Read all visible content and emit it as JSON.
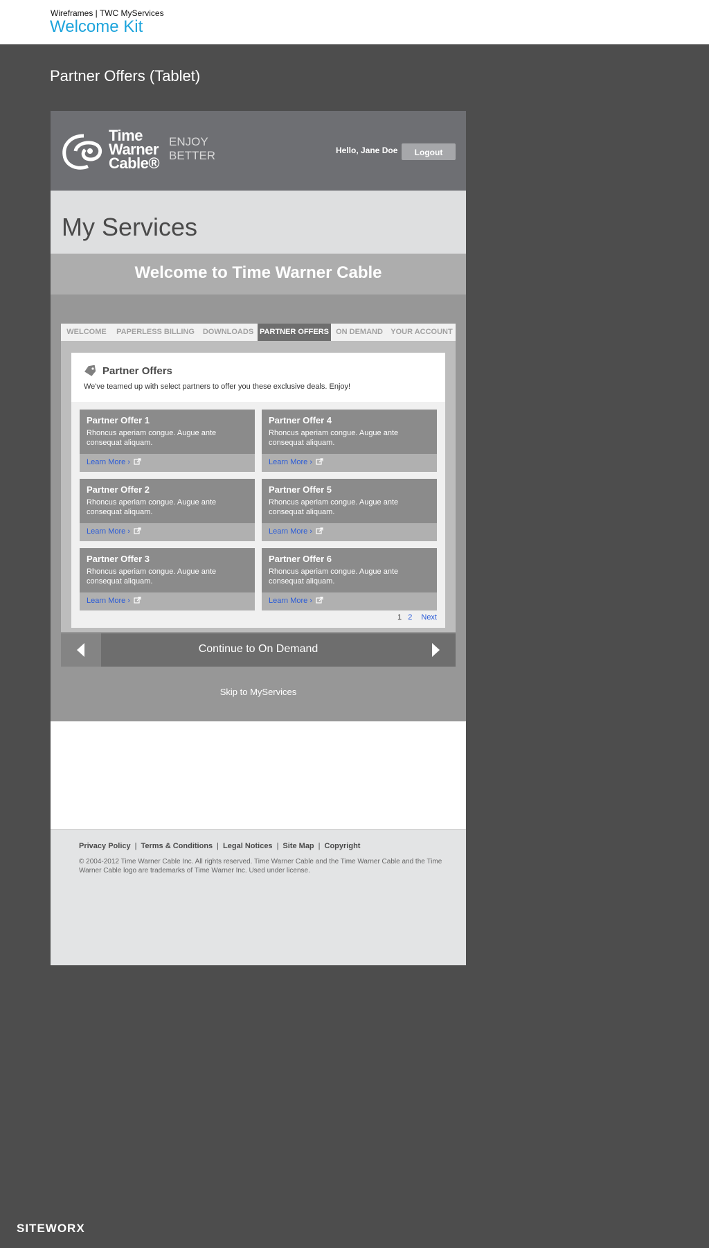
{
  "wireframe": {
    "subtitle": "Wireframes | TWC MyServices",
    "title": "Welcome Kit",
    "page_heading": "Partner Offers (Tablet)"
  },
  "header": {
    "logo_lines": [
      "Time",
      "Warner",
      "Cable®"
    ],
    "tagline_lines": [
      "ENJOY",
      "BETTER"
    ],
    "greeting": "Hello, Jane Doe",
    "logout_label": "Logout"
  },
  "my_services_title": "My Services",
  "welcome_banner": "Welcome to Time Warner Cable",
  "tabs": [
    {
      "label": "WELCOME"
    },
    {
      "label": "PAPERLESS BILLING"
    },
    {
      "label": "DOWNLOADS"
    },
    {
      "label": "PARTNER OFFERS"
    },
    {
      "label": "ON DEMAND"
    },
    {
      "label": "YOUR ACCOUNT"
    }
  ],
  "active_tab": "PARTNER OFFERS",
  "panel": {
    "title": "Partner Offers",
    "description": "We've teamed up with select partners to offer you these exclusive deals. Enjoy!"
  },
  "offers": [
    {
      "name": "Partner Offer 1",
      "description": "Rhoncus aperiam congue. Augue ante consequat aliquam.",
      "link": "Learn More ›"
    },
    {
      "name": "Partner Offer 2",
      "description": "Rhoncus aperiam congue. Augue ante consequat aliquam.",
      "link": "Learn More ›"
    },
    {
      "name": "Partner Offer 3",
      "description": "Rhoncus aperiam congue. Augue ante consequat aliquam.",
      "link": "Learn More ›"
    },
    {
      "name": "Partner Offer 4",
      "description": "Rhoncus aperiam congue. Augue ante consequat aliquam.",
      "link": "Learn More ›"
    },
    {
      "name": "Partner Offer 5",
      "description": "Rhoncus aperiam congue. Augue ante consequat aliquam.",
      "link": "Learn More ›"
    },
    {
      "name": "Partner Offer 6",
      "description": "Rhoncus aperiam congue. Augue ante consequat aliquam.",
      "link": "Learn More ›"
    }
  ],
  "pagination": {
    "page1": "1",
    "page2": "2",
    "next": "Next"
  },
  "navigation": {
    "continue_label": "Continue to On Demand",
    "skip_label": "Skip to MyServices"
  },
  "footer": {
    "links": [
      "Privacy Policy",
      "Terms & Conditions",
      "Legal Notices",
      "Site Map",
      "Copyright"
    ],
    "copyright": "© 2004-2012 Time Warner Cable Inc. All rights reserved. Time Warner Cable and the Time Warner Cable and the Time Warner Cable logo are trademarks of Time Warner Inc. Used under license."
  },
  "brand": "SITEWORX",
  "colors": {
    "accent": "#1da4dc",
    "link": "#2a5bd7",
    "page_bg": "#4d4d4d"
  }
}
